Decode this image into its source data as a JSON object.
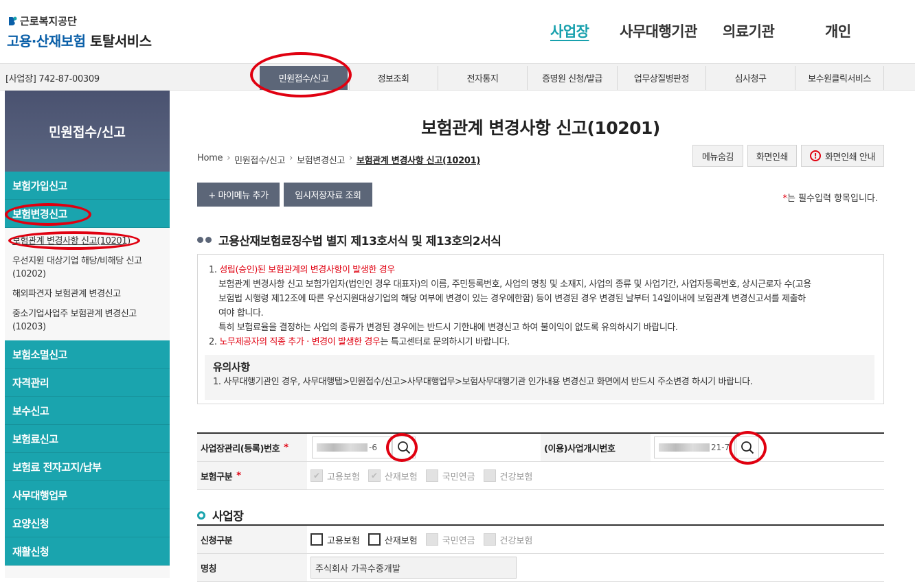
{
  "header": {
    "org_name": "근로복지공단",
    "service_title_a": "고용·산재보험",
    "service_title_b": "토탈서비스",
    "top_nav": [
      "사업장",
      "사무대행기관",
      "의료기관",
      "개인"
    ]
  },
  "gnb": {
    "biz_number": "[사업장] 742-87-00309",
    "tabs": [
      "민원접수/신고",
      "정보조회",
      "전자통지",
      "증명원 신청/발급",
      "업무상질병판정",
      "심사청구",
      "보수원클릭서비스"
    ]
  },
  "sidebar": {
    "title": "민원접수/신고",
    "menu_top": [
      "보험가입신고",
      "보험변경신고"
    ],
    "sub_items": [
      "보험관계 변경사항 신고(10201)",
      "우선지원 대상기업 해당/비해당 신고",
      "(10202)",
      "해외파견자 보험관계 변경신고",
      "중소기업사업주 보험관계 변경신고",
      "(10203)"
    ],
    "menu_bottom": [
      "보험소멸신고",
      "자격관리",
      "보수신고",
      "보험료신고",
      "보험료 전자고지/납부",
      "사무대행업무",
      "요양신청",
      "재활신청"
    ]
  },
  "page": {
    "title": "보험관계 변경사항 신고(10201)",
    "breadcrumb": [
      "Home",
      "민원접수/신고",
      "보험변경신고",
      "보험관계 변경사항 신고(10201)"
    ],
    "util_buttons": [
      "메뉴숨김",
      "화면인쇄",
      "화면인쇄 안내"
    ],
    "add_mymenu": "+ 마이메뉴 추가",
    "temp_view": "임시저장자료 조회",
    "required_note_star": "*",
    "required_note": "는 필수입력 항목입니다.",
    "section_title": "고용산재보험료징수법 별지 제13호서식 및 제13호의2서식"
  },
  "notice": {
    "item1_num": "1.",
    "item1_red": "성립(승인)된 보험관계의 변경사항이 발생한 경우",
    "item1_lines": [
      "보험관계 변경사항 신고 보험가입자(법인인 경우 대표자)의 이름, 주민등록번호, 사업의 명칭 및 소재지, 사업의 종류 및 사업기간, 사업자등록번호, 상시근로자 수(고용",
      "보험법 시행령 제12조에 따른 우선지원대상기업의 해당 여부에 변경이 있는 경우에한함) 등이 변경된 경우 변경된 날부터 14일이내에 보험관계 변경신고서를 제출하",
      "여야 합니다.",
      "특히 보험료율을 결정하는 사업의 종류가 변경된 경우에는 반드시 기한내에 변경신고 하여 불이익이 없도록 유의하시기 바랍니다."
    ],
    "item2_num": "2.",
    "item2_red": "노무제공자의 직종 추가 · 변경이 발생한 경우",
    "item2_rest": "는 특고센터로 문의하시기 바랍니다.",
    "caution_title": "유의사항",
    "caution_text": "1. 사무대행기관인 경우, 사무대행탭>민원접수/신고>사무대행업무>보험사무대행기관 인가내용 변경신고 화면에서 반드시 주소변경 하시기 바랍니다."
  },
  "form1": {
    "biz_mgmt_label": "사업장관리(등록)번호",
    "biz_mgmt_value_suffix": "-6",
    "open_no_label": "(이용)사업개시번호",
    "open_no_value_suffix": "21-7",
    "ins_type_label": "보험구분",
    "ins_types": [
      "고용보험",
      "산재보험",
      "국민연금",
      "건강보험"
    ]
  },
  "section2": {
    "title": "사업장"
  },
  "form2": {
    "apply_label": "신청구분",
    "apply_types": [
      "고용보험",
      "산재보험",
      "국민연금",
      "건강보험"
    ],
    "name_label": "명칭",
    "name_value": "주식회사 가곡수중개발"
  },
  "colors": {
    "accent": "#1aa4ae",
    "nav_dark": "#5c6678",
    "highlight": "#e00010"
  }
}
